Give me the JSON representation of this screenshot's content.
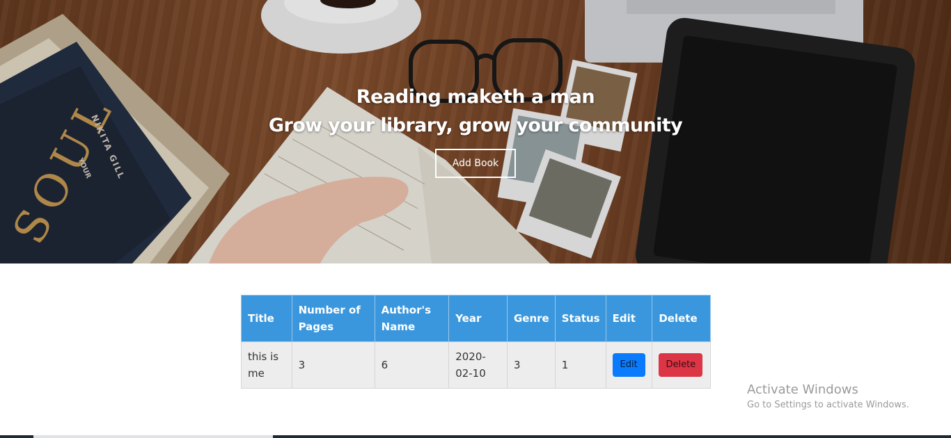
{
  "hero": {
    "title": "Reading maketh a man",
    "subtitle": "Grow your library, grow your community",
    "add_button_label": "Add Book",
    "book_cover_text": "SOUL",
    "book_spine_text": "NIKITA GILL",
    "book_spine_text2": "YOUR"
  },
  "table": {
    "headers": [
      "Title",
      "Number of Pages",
      "Author's Name",
      "Year",
      "Genre",
      "Status",
      "Edit",
      "Delete"
    ],
    "rows": [
      {
        "title": "this is me",
        "pages": "3",
        "author": "6",
        "year": "2020-02-10",
        "genre": "3",
        "status": "1",
        "edit_label": "Edit",
        "delete_label": "Delete"
      }
    ]
  },
  "watermark": {
    "title": "Activate Windows",
    "subtitle": "Go to Settings to activate Windows."
  },
  "colors": {
    "table_header": "#3a97dd",
    "edit_button": "#0a7bfc",
    "delete_button": "#dc3545"
  }
}
